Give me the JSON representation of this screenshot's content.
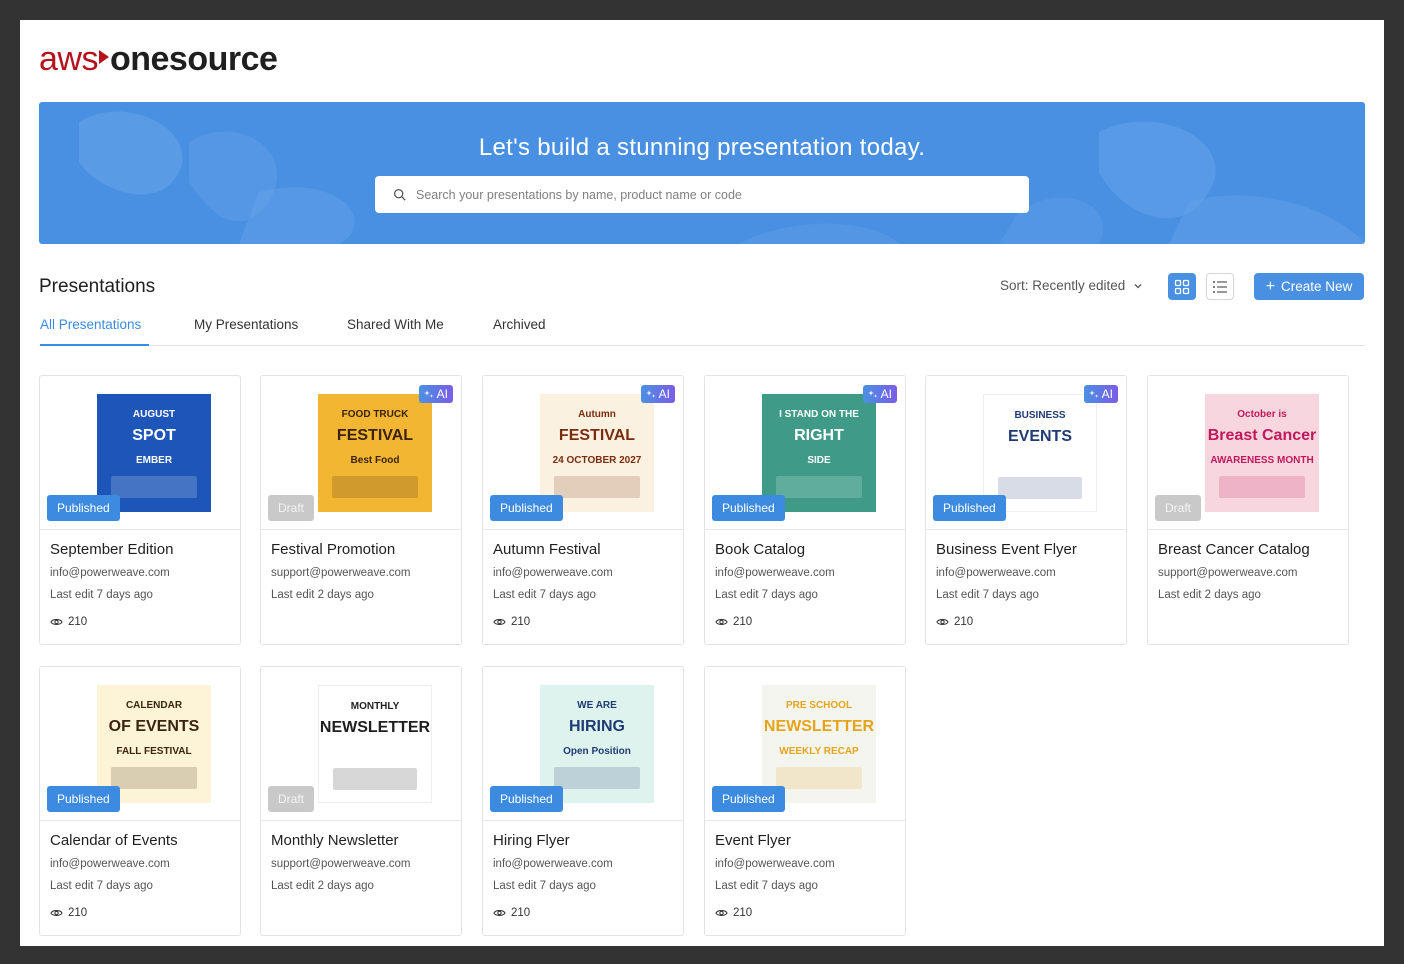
{
  "logo": {
    "part1": "aws",
    "part2": "onesource"
  },
  "hero": {
    "title": "Let's build a stunning presentation today.",
    "search_placeholder": "Search your presentations by name, product name or code"
  },
  "section": {
    "title": "Presentations"
  },
  "sort": {
    "label": "Sort: Recently edited"
  },
  "create_label": "Create New",
  "tabs": [
    {
      "label": "All Presentations",
      "active": true
    },
    {
      "label": "My Presentations",
      "active": false
    },
    {
      "label": "Shared With Me",
      "active": false
    },
    {
      "label": "Archived",
      "active": false
    }
  ],
  "ai_label": "AI",
  "cards": [
    {
      "title": "September Edition",
      "email": "info@powerweave.com",
      "edit": "Last edit 7 days ago",
      "views": "210",
      "status": "Published",
      "ai": false,
      "thumb": {
        "bg": "#1d56b8",
        "lines": [
          "AUGUST",
          "SPOT",
          "EMBER"
        ],
        "fg": "#ffffff"
      }
    },
    {
      "title": "Festival Promotion",
      "email": "support@powerweave.com",
      "edit": "Last edit 2 days ago",
      "views": "",
      "status": "Draft",
      "ai": true,
      "thumb": {
        "bg": "#f2b632",
        "lines": [
          "FOOD TRUCK",
          "FESTIVAL",
          "Best Food"
        ],
        "fg": "#3a2410"
      }
    },
    {
      "title": "Autumn Festival",
      "email": "info@powerweave.com",
      "edit": "Last edit 7 days ago",
      "views": "210",
      "status": "Published",
      "ai": true,
      "thumb": {
        "bg": "#fbf1e1",
        "lines": [
          "Autumn",
          "FESTIVAL",
          "24 OCTOBER 2027"
        ],
        "fg": "#7a2d0e"
      }
    },
    {
      "title": "Book Catalog",
      "email": "info@powerweave.com",
      "edit": "Last edit 7 days ago",
      "views": "210",
      "status": "Published",
      "ai": true,
      "thumb": {
        "bg": "#3f9b88",
        "lines": [
          "I STAND ON THE",
          "RIGHT",
          "SIDE"
        ],
        "fg": "#ffffff"
      }
    },
    {
      "title": "Business Event Flyer",
      "email": "info@powerweave.com",
      "edit": "Last edit 7 days ago",
      "views": "210",
      "status": "Published",
      "ai": true,
      "thumb": {
        "bg": "#ffffff",
        "lines": [
          "BUSINESS",
          "EVENTS",
          ""
        ],
        "fg": "#1f3b73"
      }
    },
    {
      "title": "Breast Cancer Catalog",
      "email": "support@powerweave.com",
      "edit": "Last edit 2 days ago",
      "views": "",
      "status": "Draft",
      "ai": false,
      "thumb": {
        "bg": "#f8d6df",
        "lines": [
          "October is",
          "Breast Cancer",
          "AWARENESS MONTH"
        ],
        "fg": "#c2185b"
      }
    },
    {
      "title": "Calendar of Events",
      "email": "info@powerweave.com",
      "edit": "Last edit 7 days ago",
      "views": "210",
      "status": "Published",
      "ai": false,
      "thumb": {
        "bg": "#fdf3d6",
        "lines": [
          "CALENDAR",
          "OF EVENTS",
          "FALL FESTIVAL"
        ],
        "fg": "#3a2410"
      }
    },
    {
      "title": "Monthly Newsletter",
      "email": "support@powerweave.com",
      "edit": "Last edit 2 days ago",
      "views": "",
      "status": "Draft",
      "ai": false,
      "thumb": {
        "bg": "#ffffff",
        "lines": [
          "MONTHLY",
          "NEWSLETTER",
          ""
        ],
        "fg": "#1f1f1f"
      }
    },
    {
      "title": "Hiring Flyer",
      "email": "info@powerweave.com",
      "edit": "Last edit 7 days ago",
      "views": "210",
      "status": "Published",
      "ai": false,
      "thumb": {
        "bg": "#dff3ee",
        "lines": [
          "WE ARE",
          "HIRING",
          "Open Position"
        ],
        "fg": "#1f3b73"
      }
    },
    {
      "title": "Event Flyer",
      "email": "info@powerweave.com",
      "edit": "Last edit 7 days ago",
      "views": "210",
      "status": "Published",
      "ai": false,
      "thumb": {
        "bg": "#f5f5f0",
        "lines": [
          "PRE SCHOOL",
          "NEWSLETTER",
          "WEEKLY RECAP"
        ],
        "fg": "#e5a41a"
      }
    }
  ]
}
